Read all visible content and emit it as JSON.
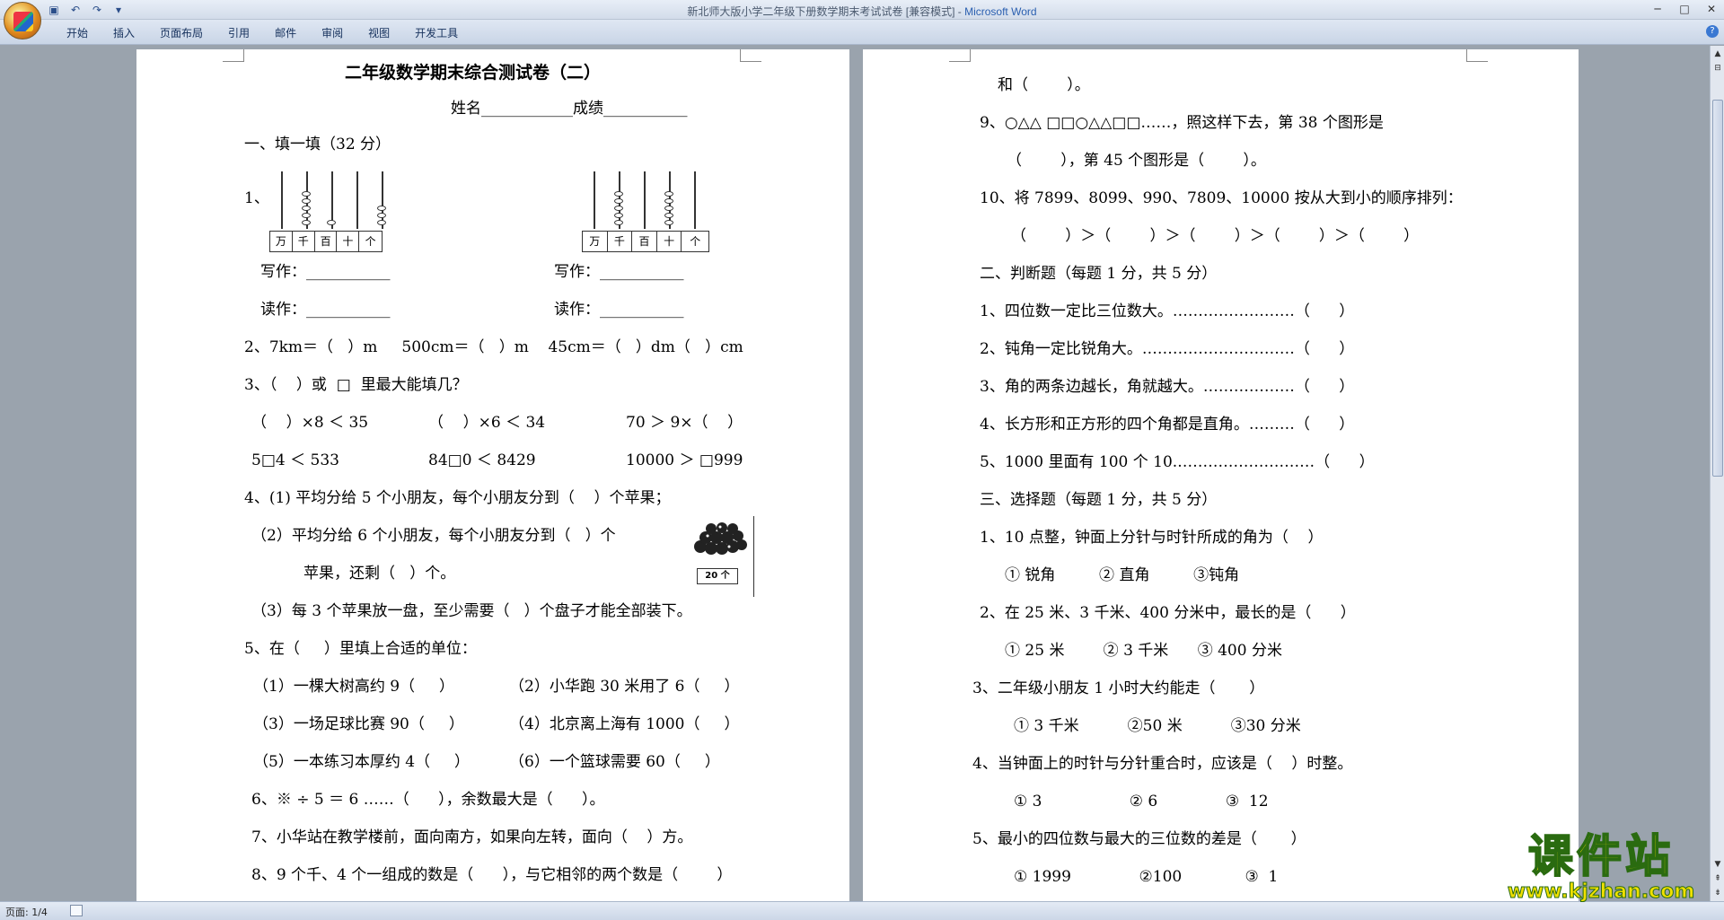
{
  "window": {
    "title_doc": "新北师大版小学二年级下册数学期末考试试卷 [兼容模式] - ",
    "title_app": "Microsoft Word"
  },
  "ribbon": {
    "tabs": [
      "开始",
      "插入",
      "页面布局",
      "引用",
      "邮件",
      "审阅",
      "视图",
      "开发工具"
    ]
  },
  "page1": {
    "title": "二年级数学期末综合测试卷（二）",
    "name_line": "姓名____________成绩___________",
    "section1": "一、填一填（32 分）",
    "q1_label": "1、",
    "abacus_units": [
      "万",
      "千",
      "百",
      "十",
      "个"
    ],
    "write1": "写作：___________",
    "write2": "写作：___________",
    "read1": "读作：___________",
    "read2": "读作：___________",
    "q2": "2、7km＝（   ）m     500cm＝（   ）m    45cm＝（   ）dm（   ）cm",
    "q3": "3、（    ）或  □  里最大能填几？",
    "q3_r1a": "（    ）×8 ＜ 35",
    "q3_r1b": "（    ）×6 ＜ 34",
    "q3_r1c": "70 ＞ 9×（    ）",
    "q3_r2a": "5□4 ＜ 533",
    "q3_r2b": "84□0 ＜ 8429",
    "q3_r2c": "10000 ＞ □999",
    "q4_1": "4、(1) 平均分给 5 个小朋友，每个小朋友分到（    ）个苹果；",
    "q4_2": "（2）平均分给 6 个小朋友，每个小朋友分到（   ）个",
    "q4_2b": "苹果，还剩（   ）个。",
    "apple_label": "20 个",
    "q4_3": "（3）每 3 个苹果放一盘，至少需要（   ）个盘子才能全部装下。",
    "q5": "5、在（     ）里填上合适的单位：",
    "q5_1": "（1）一棵大树高约 9（     ）",
    "q5_2": "（2）小华跑 30 米用了 6（     ）",
    "q5_3": "（3）一场足球比赛 90（     ）",
    "q5_4": "（4）北京离上海有 1000（     ）",
    "q5_5": "（5）一本练习本厚约 4（     ）",
    "q5_6": "（6）一个篮球需要 60（     ）",
    "q6": "6、※ ÷ 5 ＝ 6 ……（      ），余数最大是（      ）。",
    "q7": "7、小华站在教学楼前，面向南方，如果向左转，面向（    ）方。",
    "q8": "8、9 个千、4 个一组成的数是（      ），与它相邻的两个数是（        ）"
  },
  "page2": {
    "cont": "和（        ）。",
    "q9": "9、○△△ □□○△△□□……，照这样下去，第 38 个图形是",
    "q9b": "（        ），第 45 个图形是（        ）。",
    "q10": "10、将 7899、8099、990、7809、10000 按从大到小的顺序排列：",
    "q10b": "（        ）＞（        ）＞（        ）＞（        ）＞（        ）",
    "section2": "二、判断题（每题 1 分，共 5 分）",
    "j1": "1、四位数一定比三位数大。……………………（      ）",
    "j2": "2、钝角一定比锐角大。…………………………（      ）",
    "j3": "3、角的两条边越长，角就越大。………………（      ）",
    "j4": "4、长方形和正方形的四个角都是直角。………（      ）",
    "j5": "5、1000 里面有 100 个 10.………………………（      ）",
    "section3": "三、选择题（每题 1 分，共 5 分）",
    "c1": "1、10 点整，钟面上分针与时针所成的角为（    ）",
    "c1o": "① 锐角         ② 直角         ③钝角",
    "c2": "2、在 25 米、3 千米、400 分米中，最长的是（      ）",
    "c2o": "① 25 米        ② 3 千米      ③ 400 分米",
    "c3": "3、二年级小朋友 1 小时大约能走（       ）",
    "c3o": "① 3 千米          ②50 米          ③30 分米",
    "c4": "4、当钟面上的时针与分针重合时，应该是（    ）时整。",
    "c4o": "① 3                  ② 6              ③  12",
    "c5": "5、最小的四位数与最大的三位数的差是（       ）",
    "c5o": "① 1999              ②100             ③  1"
  },
  "status": {
    "page": "页面: 1/4"
  },
  "watermark": {
    "main": "课件站",
    "url": "www.kjzhan.com"
  }
}
